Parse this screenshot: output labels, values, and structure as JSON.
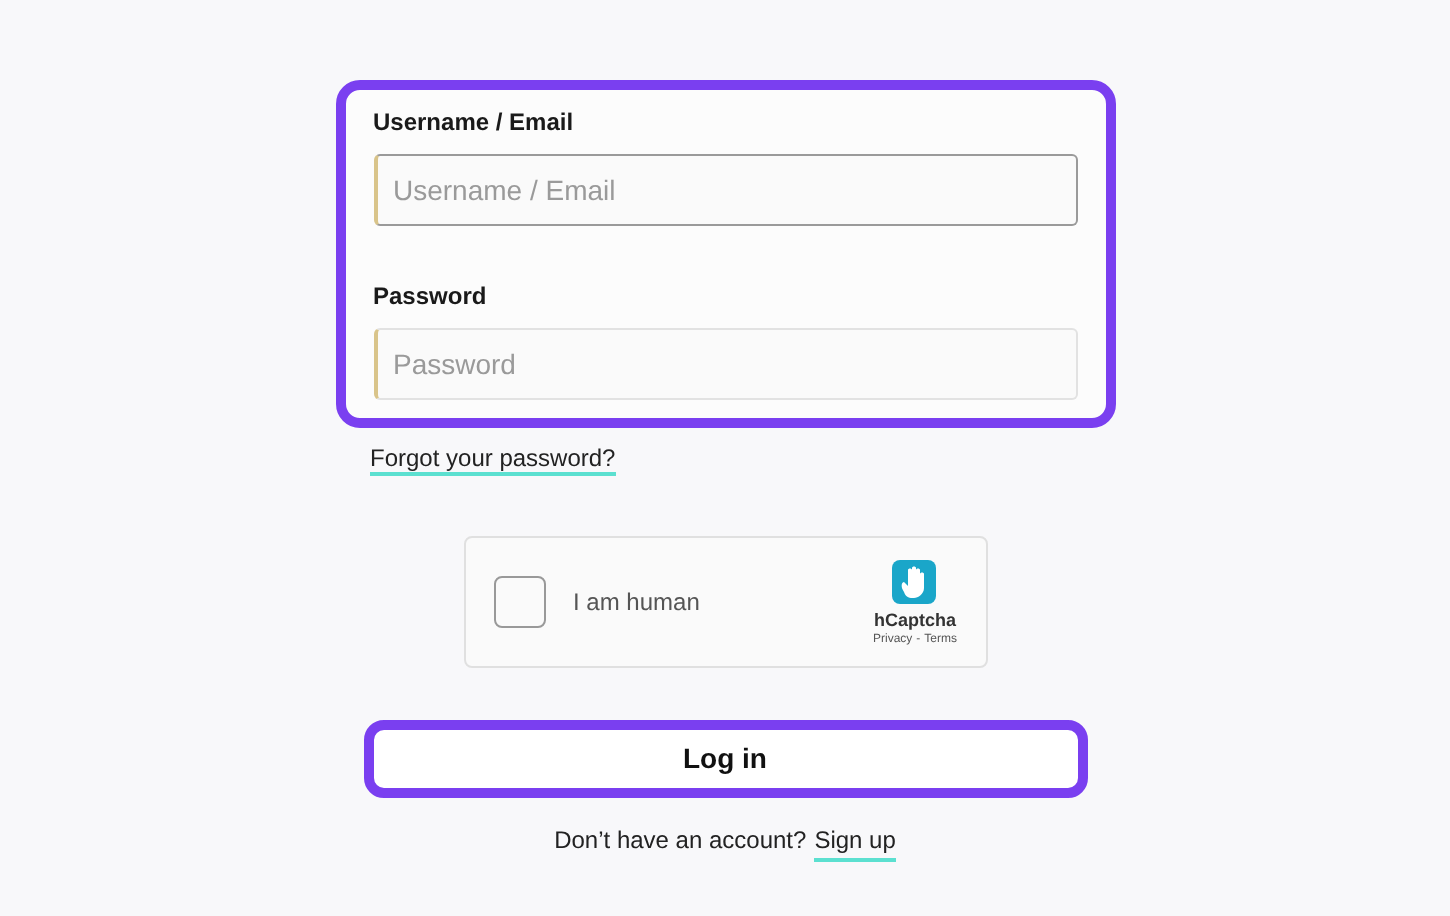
{
  "fields": [
    {
      "label": "Username / Email",
      "placeholder": "Username / Email",
      "focused": true
    },
    {
      "label": "Password",
      "placeholder": "Password",
      "focused": false
    }
  ],
  "forgot_link": "Forgot your password?",
  "captcha": {
    "label": "I am human",
    "checked": false,
    "brand": "hCaptcha",
    "privacy": "Privacy",
    "separator": "-",
    "terms": "Terms"
  },
  "login_button": "Log in",
  "signup": {
    "prompt": "Don’t have an account?",
    "link": "Sign up"
  }
}
